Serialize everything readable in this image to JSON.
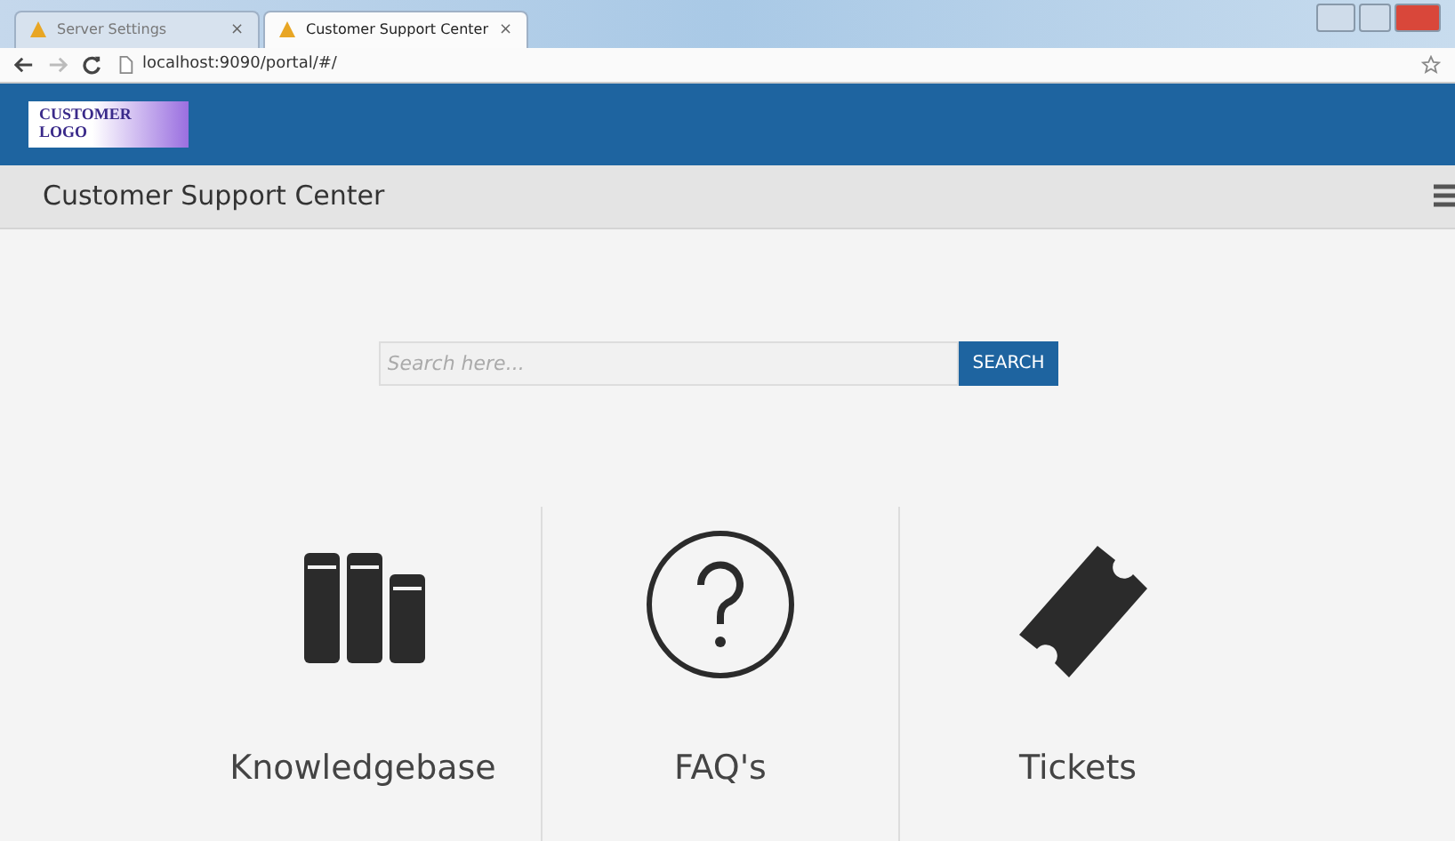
{
  "browser": {
    "tabs": [
      {
        "label": "Server Settings",
        "selected": false,
        "close": "×"
      },
      {
        "label": "Customer Support Center",
        "selected": true,
        "close": "×"
      }
    ],
    "address": "localhost:9090/portal/#/"
  },
  "header": {
    "logo": "CUSTOMER LOGO"
  },
  "title_bar": {
    "title": "Customer Support Center"
  },
  "search": {
    "placeholder": "Search here...",
    "button": "SEARCH"
  },
  "sections": [
    {
      "kind": "books",
      "label": "Knowledgebase"
    },
    {
      "kind": "question",
      "label": "FAQ's"
    },
    {
      "kind": "ticket",
      "label": "Tickets"
    }
  ]
}
